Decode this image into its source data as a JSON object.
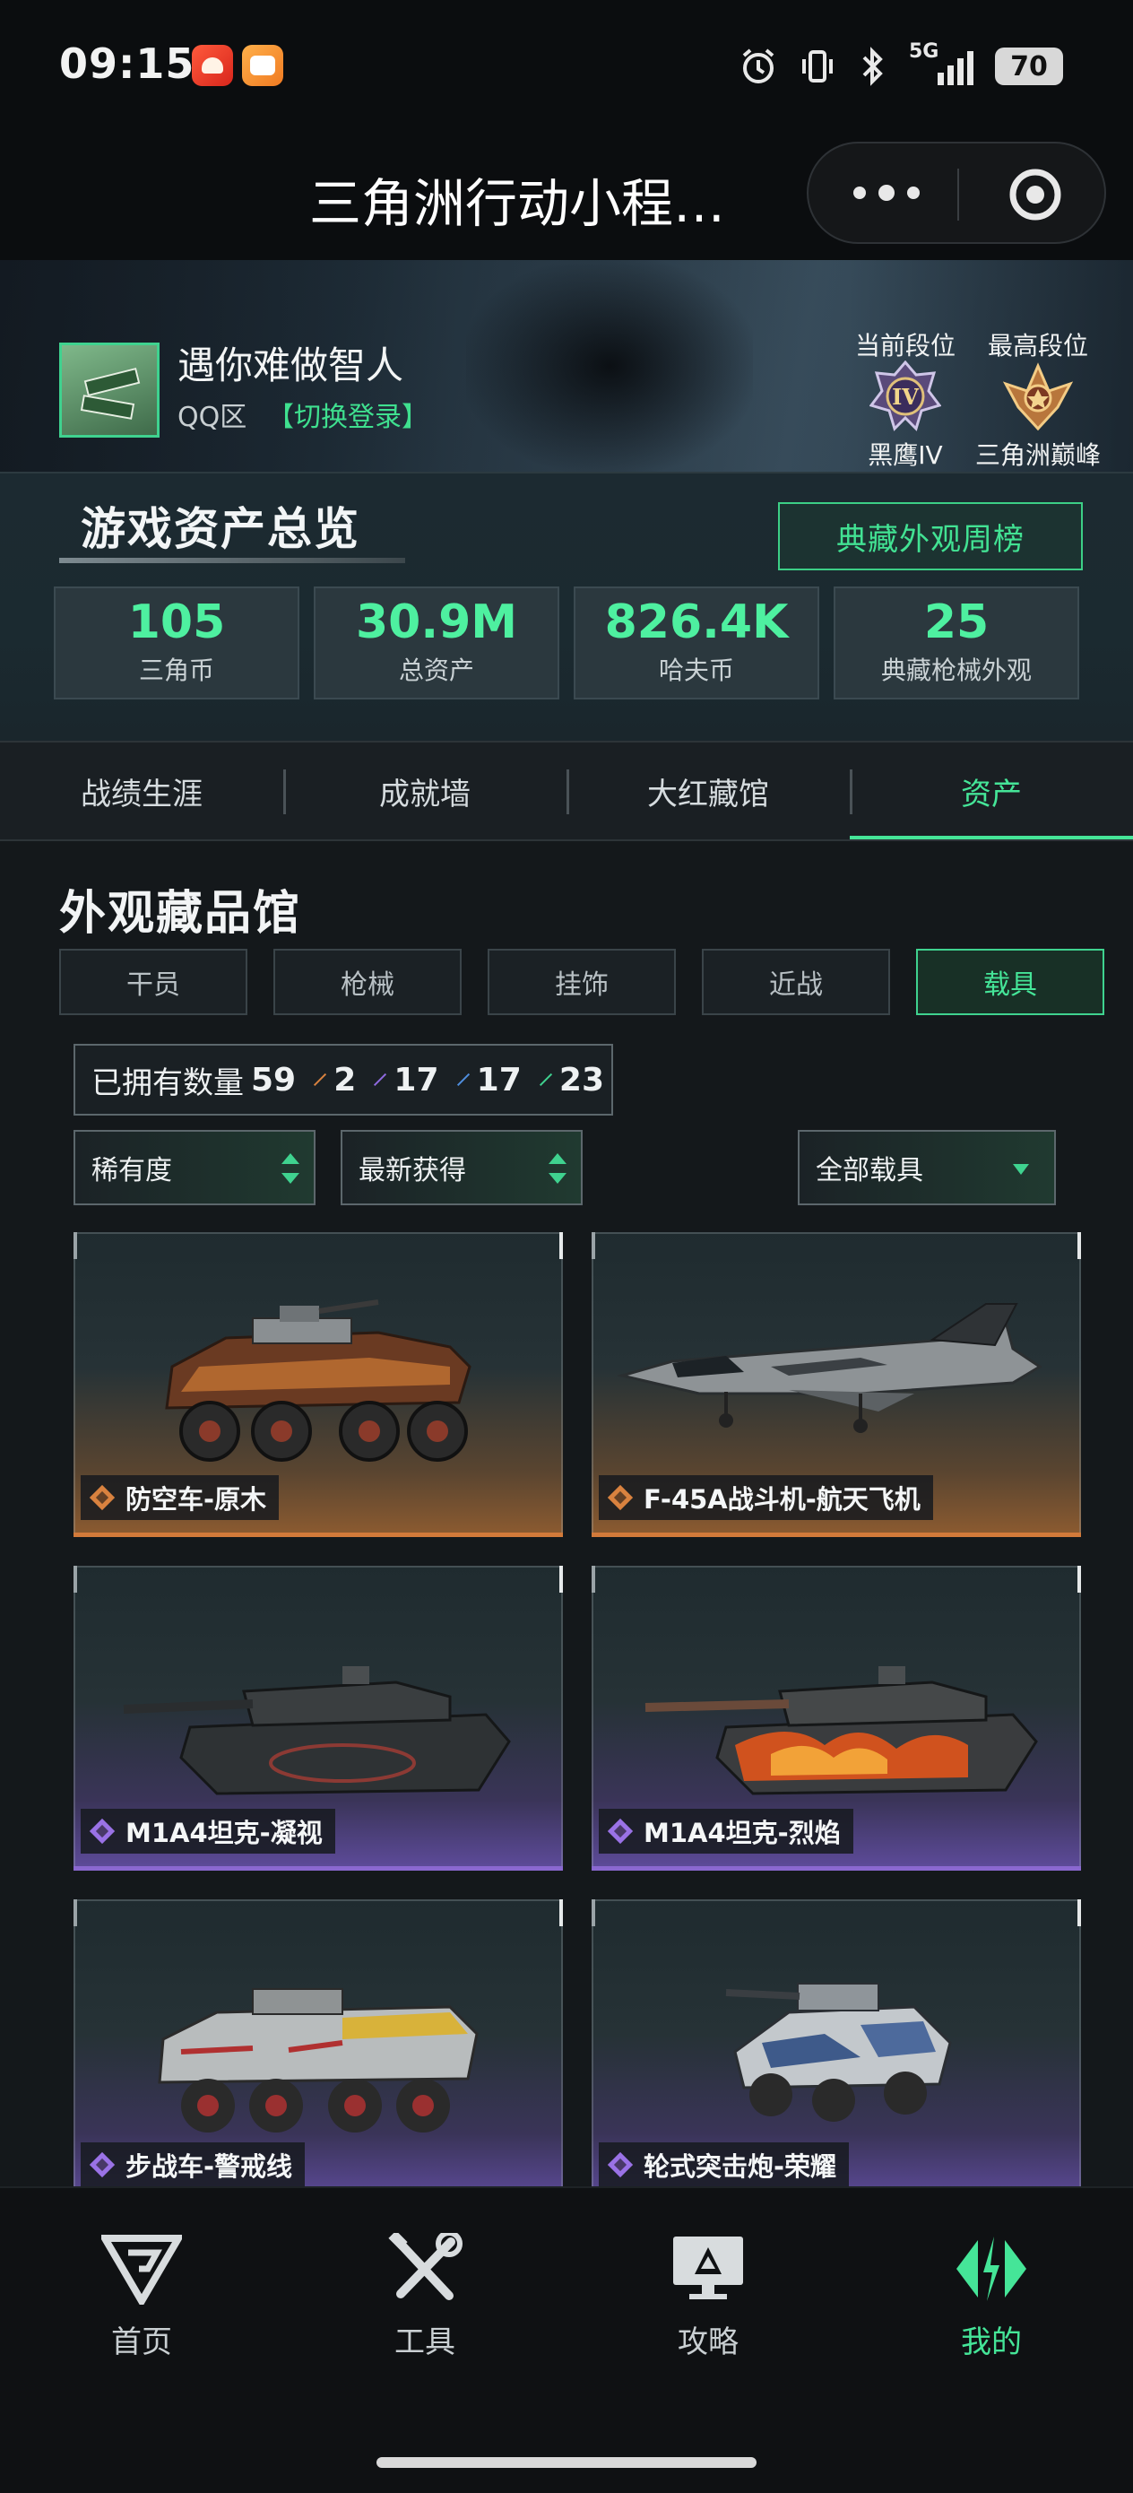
{
  "status_bar": {
    "time": "09:15",
    "network": "5G",
    "battery": "70",
    "icons": [
      "app-red-icon",
      "app-orange-icon",
      "alarm-icon",
      "vibrate-icon",
      "bluetooth-icon",
      "signal-icon",
      "battery-icon"
    ]
  },
  "title_bar": {
    "title": "三角洲行动小程…",
    "more_icon": "ellipsis-icon",
    "close_icon": "target-icon"
  },
  "profile": {
    "nickname": "遇你难做智人",
    "zone": "QQ区",
    "switch_login": "【切换登录】",
    "current_rank_label": "当前段位",
    "current_rank": "黑鹰IV",
    "highest_rank_label": "最高段位",
    "highest_rank": "三角洲巅峰"
  },
  "overview": {
    "title": "游戏资产总览",
    "weekly_button": "典藏外观周榜",
    "stats": [
      {
        "value": "105",
        "label": "三角币"
      },
      {
        "value": "30.9M",
        "label": "总资产"
      },
      {
        "value": "826.4K",
        "label": "哈夫币"
      },
      {
        "value": "25",
        "label": "典藏枪械外观"
      }
    ]
  },
  "tabs": [
    "战绩生涯",
    "成就墙",
    "大红藏馆",
    "资产"
  ],
  "active_tab": "资产",
  "collection": {
    "title": "外观藏品馆",
    "categories": [
      "干员",
      "枪械",
      "挂饰",
      "近战",
      "载具"
    ],
    "active_category": "载具",
    "owned_label": "已拥有数量",
    "owned_total": "59",
    "rarity_counts": [
      {
        "count": "2",
        "color": "#d9823f"
      },
      {
        "count": "17",
        "color": "#8f6ae0"
      },
      {
        "count": "17",
        "color": "#4f8ede"
      },
      {
        "count": "23",
        "color": "#3fd28f"
      }
    ],
    "sort_rarity": "稀有度",
    "sort_latest": "最新获得",
    "filter_all": "全部载具",
    "items": [
      {
        "name": "防空车-原木",
        "rarity": "orange",
        "color": "#d9823f"
      },
      {
        "name": "F-45A战斗机-航天飞机",
        "rarity": "orange",
        "color": "#d9823f"
      },
      {
        "name": "M1A4坦克-凝视",
        "rarity": "purple",
        "color": "#9a72e6"
      },
      {
        "name": "M1A4坦克-烈焰",
        "rarity": "purple",
        "color": "#9a72e6"
      },
      {
        "name": "步战车-警戒线",
        "rarity": "purple",
        "color": "#9a72e6"
      },
      {
        "name": "轮式突击炮-荣耀",
        "rarity": "purple",
        "color": "#9a72e6"
      }
    ]
  },
  "bottom_nav": [
    {
      "label": "首页",
      "icon": "delta-logo-icon"
    },
    {
      "label": "工具",
      "icon": "tools-icon"
    },
    {
      "label": "攻略",
      "icon": "guide-monitor-icon"
    },
    {
      "label": "我的",
      "icon": "profile-logo-icon"
    }
  ],
  "active_nav": "我的",
  "accent_color": "#45e598"
}
